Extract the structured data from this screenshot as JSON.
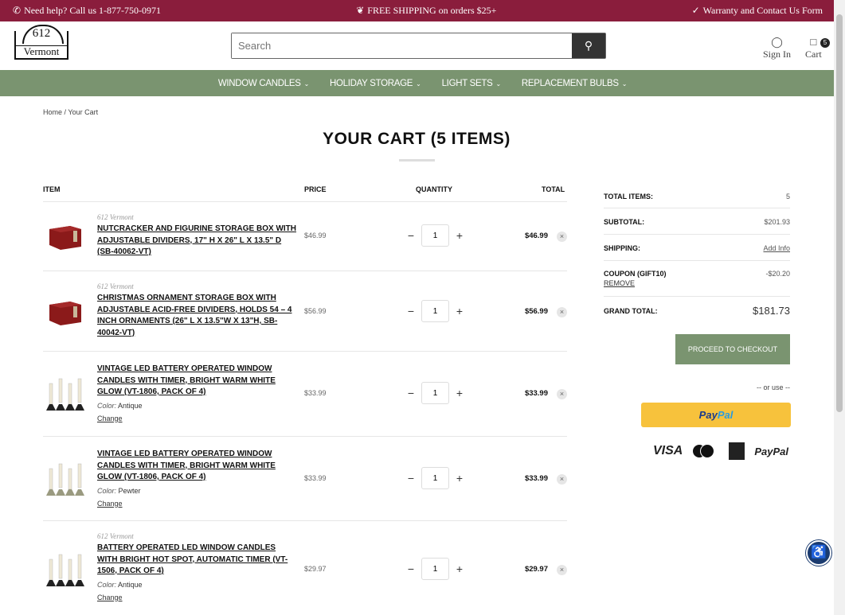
{
  "topbar": {
    "help": "Need help? Call us 1-877-750-0971",
    "shipping": "FREE SHIPPING on orders $25+",
    "warranty": "Warranty and Contact Us Form"
  },
  "logo": {
    "line1": "612",
    "line2": "Vermont"
  },
  "search": {
    "placeholder": "Search"
  },
  "account": {
    "sign_in": "Sign In",
    "cart": "Cart",
    "cart_count": "5"
  },
  "nav": [
    {
      "label": "WINDOW CANDLES"
    },
    {
      "label": "HOLIDAY STORAGE"
    },
    {
      "label": "LIGHT SETS"
    },
    {
      "label": "REPLACEMENT BULBS"
    }
  ],
  "breadcrumb": {
    "home": "Home",
    "sep": "/",
    "current": "Your Cart"
  },
  "page_title": "YOUR CART (5 ITEMS)",
  "columns": {
    "item": "ITEM",
    "price": "PRICE",
    "quantity": "QUANTITY",
    "total": "TOTAL"
  },
  "items": [
    {
      "brand": "612 Vermont",
      "name": "NUTCRACKER AND FIGURINE STORAGE BOX WITH ADJUSTABLE DIVIDERS, 17\" H X 26\" L X 13.5\" D (SB-40062-VT)",
      "price": "$46.99",
      "qty": "1",
      "total": "$46.99",
      "kind": "box"
    },
    {
      "brand": "612 Vermont",
      "name": "CHRISTMAS ORNAMENT STORAGE BOX WITH ADJUSTABLE ACID-FREE DIVIDERS, HOLDS 54 – 4 INCH ORNAMENTS (26\" L X 13.5\"W X 13\"H, SB-40042-VT)",
      "price": "$56.99",
      "qty": "1",
      "total": "$56.99",
      "kind": "box"
    },
    {
      "name": "VINTAGE LED BATTERY OPERATED WINDOW CANDLES WITH TIMER, BRIGHT WARM WHITE GLOW (VT-1806, PACK OF 4)",
      "option_label": "Color:",
      "option_value": "Antique",
      "change": "Change",
      "price": "$33.99",
      "qty": "1",
      "total": "$33.99",
      "kind": "candle"
    },
    {
      "name": "VINTAGE LED BATTERY OPERATED WINDOW CANDLES WITH TIMER, BRIGHT WARM WHITE GLOW (VT-1806, PACK OF 4)",
      "option_label": "Color:",
      "option_value": "Pewter",
      "change": "Change",
      "price": "$33.99",
      "qty": "1",
      "total": "$33.99",
      "kind": "candle"
    },
    {
      "brand": "612 Vermont",
      "name": "BATTERY OPERATED LED WINDOW CANDLES WITH BRIGHT HOT SPOT, AUTOMATIC TIMER (VT-1506, PACK OF 4)",
      "option_label": "Color:",
      "option_value": "Antique",
      "change": "Change",
      "price": "$29.97",
      "qty": "1",
      "total": "$29.97",
      "kind": "candle"
    }
  ],
  "summary": {
    "total_items_label": "TOTAL ITEMS:",
    "total_items": "5",
    "subtotal_label": "SUBTOTAL:",
    "subtotal": "$201.93",
    "shipping_label": "SHIPPING:",
    "shipping": "Add Info",
    "coupon_label": "COUPON (GIFT10)",
    "coupon": "-$20.20",
    "remove": "REMOVE",
    "grand_total_label": "GRAND TOTAL:",
    "grand_total": "$181.73",
    "checkout": "PROCEED TO CHECKOUT",
    "or_use": "-- or use --",
    "paypal_a": "Pay",
    "paypal_b": "Pal",
    "cards": {
      "visa": "VISA",
      "paypal": "PayPal"
    }
  },
  "colors": {
    "topbar": "#8a1d3c",
    "nav": "#7a9470",
    "paypal": "#f7c23c"
  }
}
